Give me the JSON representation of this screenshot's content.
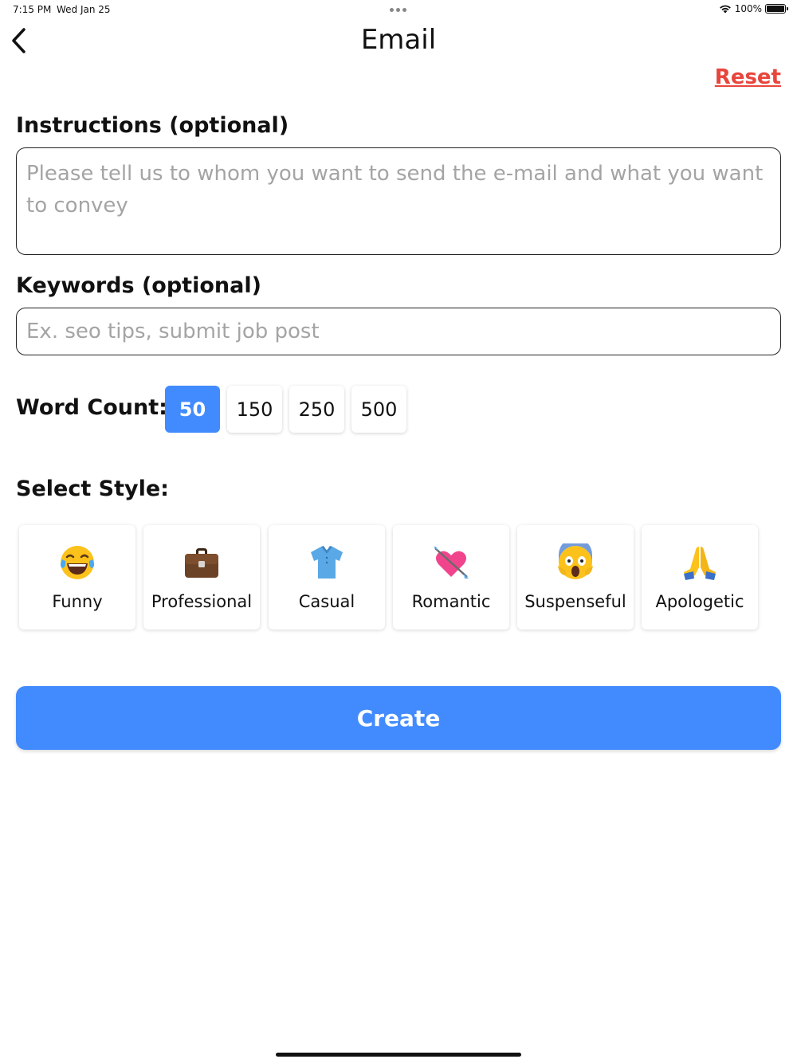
{
  "status_bar": {
    "time": "7:15 PM",
    "date": "Wed Jan 25",
    "battery": "100%"
  },
  "header": {
    "title": "Email",
    "back_icon": "chevron-left-icon"
  },
  "reset_label": "Reset",
  "instructions": {
    "label": "Instructions (optional)",
    "placeholder": "Please tell us to whom you want to send the e-mail and what you want to convey",
    "value": ""
  },
  "keywords": {
    "label": "Keywords (optional)",
    "placeholder": "Ex. seo tips, submit job post",
    "value": ""
  },
  "word_count": {
    "label": "Word Count:",
    "options": [
      "50",
      "150",
      "250",
      "500"
    ],
    "selected": "50"
  },
  "style": {
    "label": "Select Style:",
    "options": [
      {
        "label": "Funny",
        "icon": "tears-of-joy-icon"
      },
      {
        "label": "Professional",
        "icon": "briefcase-icon"
      },
      {
        "label": "Casual",
        "icon": "shirt-icon"
      },
      {
        "label": "Romantic",
        "icon": "heart-arrow-icon"
      },
      {
        "label": "Suspenseful",
        "icon": "screaming-face-icon"
      },
      {
        "label": "Apologetic",
        "icon": "folded-hands-icon"
      }
    ]
  },
  "create_label": "Create",
  "colors": {
    "accent": "#428bff",
    "reset": "#e8453c",
    "placeholder": "#a4a4a4"
  }
}
